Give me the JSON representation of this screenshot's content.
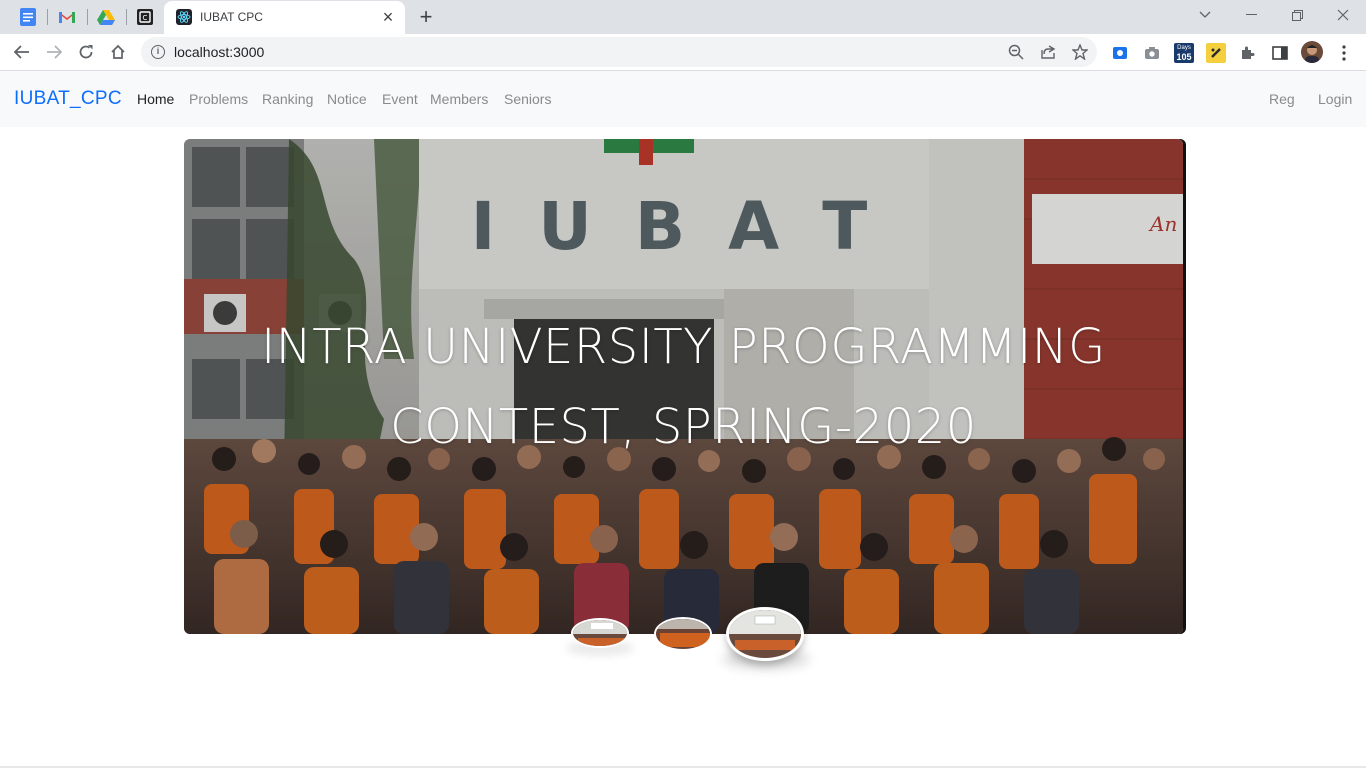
{
  "browser": {
    "tab_title": "IUBAT CPC",
    "url": "localhost:3000",
    "extension_badge": "105",
    "extension_badge_label": "Days",
    "pinned_tabs": [
      "docs-icon",
      "gmail-icon",
      "drive-icon",
      "codeforces-icon"
    ]
  },
  "site": {
    "brand": "IUBAT_CPC",
    "nav": [
      {
        "label": "Home",
        "active": true
      },
      {
        "label": "Problems",
        "active": false
      },
      {
        "label": "Ranking",
        "active": false
      },
      {
        "label": "Notice",
        "active": false
      },
      {
        "label": "Event",
        "active": false
      },
      {
        "label": "Members",
        "active": false
      },
      {
        "label": "Seniors",
        "active": false
      }
    ],
    "auth": {
      "register": "Reg",
      "login": "Login"
    }
  },
  "hero": {
    "building_sign": "I U B A T",
    "wall_sign": "An",
    "title_line1": "INTRA UNIVERSITY PROGRAMMING",
    "title_line2": "CONTEST, SPRING-2020",
    "active_slide": 3,
    "slide_count": 3
  },
  "colors": {
    "brand": "#0d6efd",
    "navbar_bg": "#f8f9fa",
    "tabstrip_bg": "#dee1e6"
  }
}
